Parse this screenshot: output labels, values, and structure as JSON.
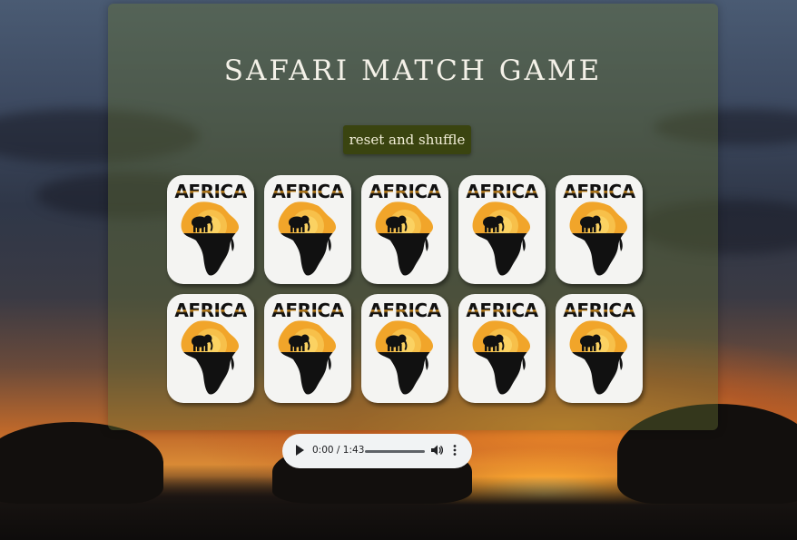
{
  "game": {
    "title": "SAFARI MATCH GAME",
    "reset_label": "reset and shuffle"
  },
  "cards": [
    {
      "label": "AFRICA"
    },
    {
      "label": "AFRICA"
    },
    {
      "label": "AFRICA"
    },
    {
      "label": "AFRICA"
    },
    {
      "label": "AFRICA"
    },
    {
      "label": "AFRICA"
    },
    {
      "label": "AFRICA"
    },
    {
      "label": "AFRICA"
    },
    {
      "label": "AFRICA"
    },
    {
      "label": "AFRICA"
    }
  ],
  "audio": {
    "time": "0:00 / 1:43",
    "progress": 0,
    "play_icon": "play-icon",
    "volume_icon": "volume-icon",
    "more_icon": "more-options-icon"
  },
  "colors": {
    "panel": "#646e32",
    "button": "#3a4410",
    "card": "#f4f4f2",
    "sun_orange": "#e79a1c"
  }
}
